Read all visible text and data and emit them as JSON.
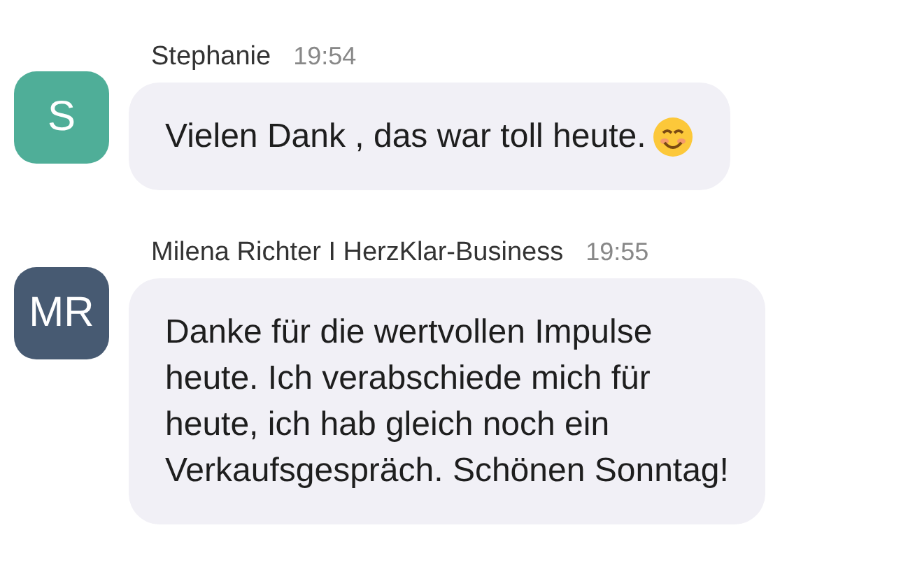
{
  "messages": [
    {
      "author": "Stephanie",
      "time": "19:54",
      "avatar": "S",
      "color": "#4fae98",
      "lines": [
        "Vielen Dank , das war toll heute."
      ],
      "emoji": true
    },
    {
      "author": "Milena Richter I HerzKlar-Business",
      "time": "19:55",
      "avatar": "MR",
      "color": "#475a72",
      "lines": [
        "Danke für die wertvollen Impulse",
        "heute. Ich verabschiede mich für",
        "heute, ich hab gleich noch ein",
        "Verkaufsgespräch. Schönen Sonntag!"
      ],
      "emoji": false
    }
  ]
}
